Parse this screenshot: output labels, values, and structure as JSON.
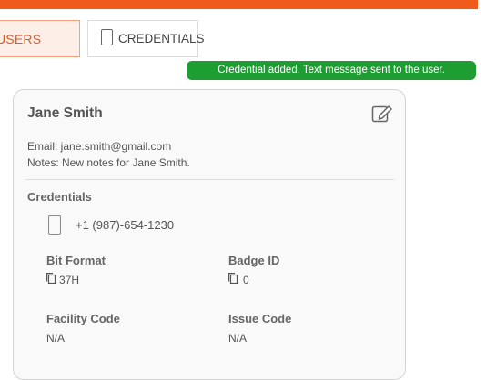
{
  "tabs": {
    "users_label": "USERS",
    "credentials_label": "CREDENTIALS"
  },
  "toast": {
    "message": "Credential added. Text message sent to the user."
  },
  "user": {
    "name": "Jane Smith",
    "email": "Email: jane.smith@gmail.com",
    "notes": "Notes: New notes for Jane Smith."
  },
  "credentials": {
    "title": "Credentials",
    "phone": "+1 (987)-654-1230",
    "bit_format_label": "Bit Format",
    "bit_format_value": "37H",
    "badge_id_label": "Badge ID",
    "badge_id_value": "0",
    "facility_code_label": "Facility Code",
    "facility_code_value": "N/A",
    "issue_code_label": "Issue Code",
    "issue_code_value": "N/A"
  },
  "colors": {
    "accent": "#f05a1a",
    "toast_bg": "#1e9e32"
  },
  "icons": [
    "phone-icon",
    "edit-icon",
    "copy-icon"
  ]
}
